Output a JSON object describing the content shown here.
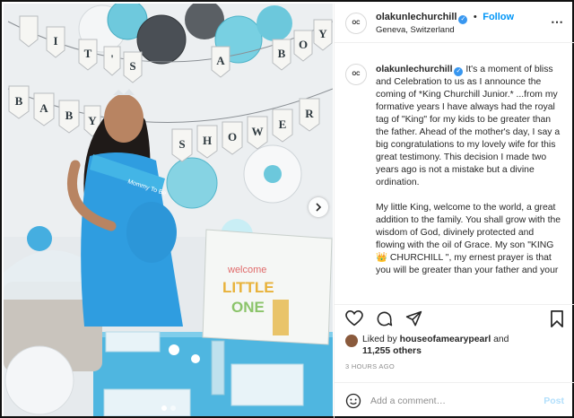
{
  "banner": {
    "line1": [
      "I",
      "T",
      "'",
      "S",
      "A",
      "B",
      "O",
      "Y"
    ],
    "line2": [
      "B",
      "A",
      "B",
      "Y",
      "S",
      "H",
      "O",
      "W",
      "E",
      "R"
    ]
  },
  "gift_bag": {
    "line1": "welcome",
    "line2": "LITTLE",
    "line3": "ONE"
  },
  "sash_text": "Mommy To Be",
  "post": {
    "avatar_text": "OC",
    "username": "olakunlechurchill",
    "verified_icon": "verified-badge-icon",
    "separator": "•",
    "follow_label": "Follow",
    "location": "Geneva, Switzerland",
    "more_icon": "⋯"
  },
  "caption": {
    "username": "olakunlechurchill",
    "paragraph1": "It's a moment of bliss and Celebration to us as I announce the coming of *King Churchill Junior.* ...from my formative years I have always had the royal tag of \"King\" for my kids to be greater than the father. Ahead of the mother's day, I say a big congratulations to my lovely wife for this great testimony. This decision I made two years ago is not a mistake but a divine ordination.",
    "paragraph2": "My little King, welcome to the world, a great addition to the family. You shall grow with the wisdom of God, divinely protected and flowing with the oil of Grace. My son \"KING 👑 CHURCHILL \", my ernest prayer is that you will be greater than your father and your"
  },
  "likes": {
    "prefix": "Liked by",
    "liker": "houseofamearypearl",
    "conjunction": "and",
    "count": "11,255 others"
  },
  "timestamp": "3 HOURS AGO",
  "comment": {
    "placeholder": "Add a comment…",
    "post_label": "Post"
  },
  "colors": {
    "accent": "#0095f6",
    "verified": "#3897f0",
    "post_disabled": "#b2dffc",
    "muted": "#8e8e8e",
    "sash": "#43b5e6"
  }
}
